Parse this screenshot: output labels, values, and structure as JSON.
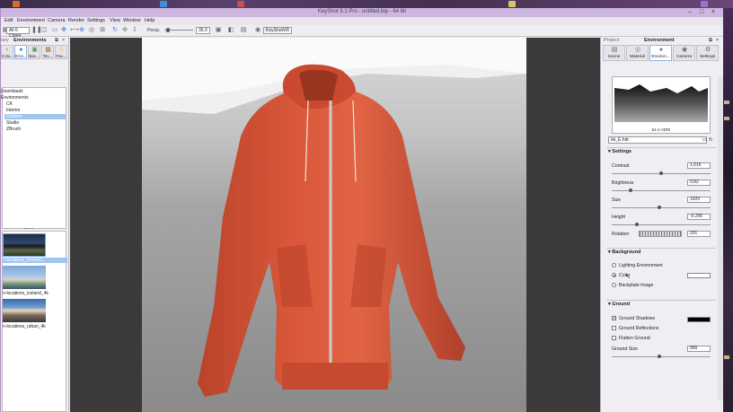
{
  "window": {
    "title": "KeyShot 5.1 Pro - untitled.bip - 64 bit"
  },
  "menu": [
    "Edit",
    "Environment",
    "Camera",
    "Render",
    "Settings",
    "View",
    "Window",
    "Help"
  ],
  "toolbar": {
    "cores": "All 6 Cores",
    "persp_label": "Persp.",
    "persp_value": "35.0",
    "keyshotvr": "KeyShotVR"
  },
  "left_panel": {
    "title": "Environments",
    "prefix": "Library",
    "tabs": [
      "Colors",
      "Environments",
      "Backplates",
      "Textures",
      "Favorites"
    ],
    "tabs_short": [
      "Colo...",
      "Envi...",
      "Bac...",
      "Tex...",
      "Fav..."
    ],
    "tree": [
      {
        "label": "Downloads",
        "indent": 0
      },
      {
        "label": "Environments",
        "indent": 0
      },
      {
        "label": "CK",
        "indent": 1
      },
      {
        "label": "Interior",
        "indent": 1
      },
      {
        "label": "Outdoor",
        "indent": 1,
        "selected": true
      },
      {
        "label": "Studio",
        "indent": 1
      },
      {
        "label": "ZBrush",
        "indent": 1
      }
    ],
    "thumbs": [
      {
        "label": "n-locations_forestro..."
      },
      {
        "label": "n-locations_iceland_4k"
      },
      {
        "label": "n-locations_urban_4k"
      }
    ]
  },
  "right_panel": {
    "prefix": "Project",
    "title": "Environment",
    "tabs": [
      "Scene",
      "Material",
      "Environ...",
      "Camera",
      "Settings"
    ],
    "hdr_name": "64 k HDRI",
    "file": "bk_E.hdr",
    "settings_title": "Settings",
    "props": [
      {
        "label": "Contrast",
        "value": "1.016",
        "knob": 0.5
      },
      {
        "label": "Brightness",
        "value": "0.82",
        "knob": 0.2
      },
      {
        "label": "Size",
        "value": "1920",
        "knob": 0.48
      },
      {
        "label": "Height",
        "value": "-0.256",
        "knob": 0.26
      }
    ],
    "rotation_label": "Rotation",
    "rotation_value": "201",
    "background_title": "Background",
    "background_options": [
      {
        "label": "Lighting Environment",
        "selected": false
      },
      {
        "label": "Color",
        "selected": true
      },
      {
        "label": "Backplate image",
        "selected": false
      }
    ],
    "ground_title": "Ground",
    "ground_options": [
      {
        "label": "Ground Shadows",
        "checked": true
      },
      {
        "label": "Ground Reflections",
        "checked": false
      },
      {
        "label": "Flatten Ground",
        "checked": false
      }
    ],
    "ground_size_label": "Ground Size",
    "ground_size_value": "900",
    "colors": {
      "background_color": "#ffffff",
      "shadow_color": "#000000"
    }
  }
}
